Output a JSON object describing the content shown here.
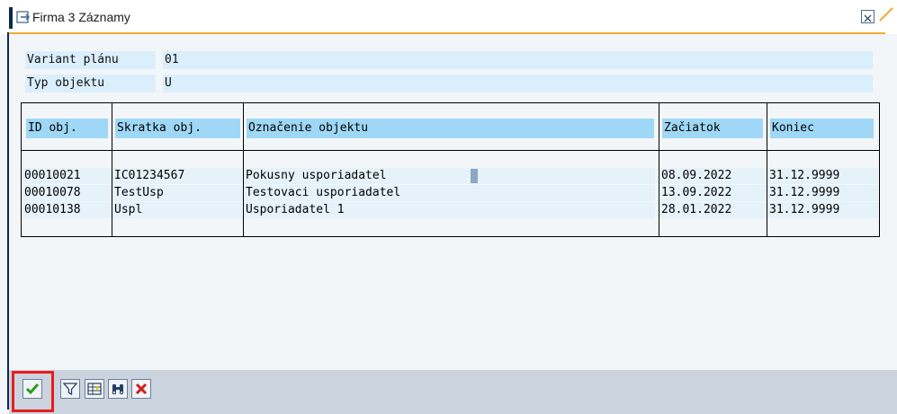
{
  "window": {
    "title": "Firma 3 Záznamy"
  },
  "fields": [
    {
      "label": "Variant plánu",
      "value": "01"
    },
    {
      "label": "Typ objektu",
      "value": "U"
    }
  ],
  "table": {
    "columns": [
      "ID obj.",
      "Skratka obj.",
      "Označenie objektu",
      "Začiatok",
      "Koniec"
    ],
    "rows": [
      [
        "00010021",
        "IC01234567",
        "Pokusny usporiadatel",
        "08.09.2022",
        "31.12.9999"
      ],
      [
        "00010078",
        "TestUsp",
        "Testovaci usporiadatel",
        "13.09.2022",
        "31.12.9999"
      ],
      [
        "00010138",
        "Uspl",
        "Usporiadatel 1",
        "28.01.2022",
        "31.12.9999"
      ]
    ]
  },
  "toolbar": {
    "buttons": [
      "confirm-icon",
      "filter-icon",
      "new-entry-icon",
      "find-icon",
      "cancel-icon"
    ]
  },
  "colors": {
    "title_accent": "#0a2a55",
    "title_line": "#f0ad2e",
    "header_cell": "#9fd7f7",
    "field_bg": "#dbeefc",
    "toolbar_bg": "#cbd3de",
    "highlight": "#e81d1d",
    "confirm_green": "#2d9a1e",
    "cancel_red": "#d61a1a"
  }
}
